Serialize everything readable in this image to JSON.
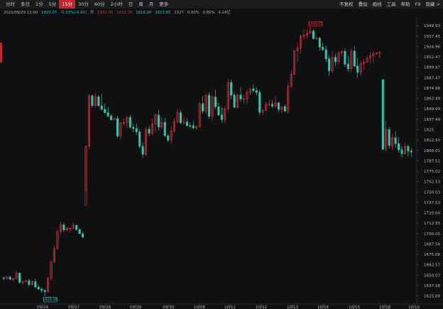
{
  "toolbar": {
    "tabs": [
      {
        "label": "分时",
        "active": false
      },
      {
        "label": "多日",
        "active": false
      },
      {
        "label": "1分",
        "active": false
      },
      {
        "label": "5分",
        "active": false
      },
      {
        "label": "15分",
        "active": true
      },
      {
        "label": "30分",
        "active": false
      },
      {
        "label": "60分",
        "active": false
      },
      {
        "label": "2小时",
        "active": false
      },
      {
        "label": "日",
        "active": false
      },
      {
        "label": "周",
        "active": false
      },
      {
        "label": "月",
        "active": false
      },
      {
        "label": "更多",
        "active": false
      }
    ],
    "right_items": [
      "不复权",
      "叠加",
      "画线",
      "工具",
      "帮助",
      "F9",
      "隐藏 >"
    ]
  },
  "info": {
    "datetime": "2021/09/29 11:00",
    "price": "1820.07",
    "change": "-0.33%(-6.65)",
    "open_label": "开",
    "open": "1832.00",
    "high": "1832.38",
    "low": "1818.00",
    "close": "1823.85",
    "volume": "2327",
    "pct1": "0.00%",
    "pct2": "0.85%",
    "amount": "4.24亿"
  },
  "colors": {
    "up": "#e2373d",
    "down": "#2fc8b0",
    "background": "#0f1011",
    "grid": "#1d1f22"
  },
  "chart_data": {
    "type": "candlestick",
    "y_ticks": [
      "1949.93",
      "1937.45",
      "1924.96",
      "1912.47",
      "1899.97",
      "1887.47",
      "1874.98",
      "1862.49",
      "1849.99",
      "1837.49",
      "1825",
      "1812.50",
      "1800.01",
      "1787.51",
      "1775.02",
      "1762.53",
      "1750.03",
      "1737.53",
      "1725.04",
      "1712.55",
      "1700.05",
      "1687.56",
      "1675.06",
      "1662.57",
      "1650.07",
      "1637.58",
      "1625.08"
    ],
    "x_labels": [
      "09/24",
      "09/27",
      "09/28",
      "09/29",
      "09/30",
      "10/08",
      "10/11",
      "10/12",
      "10/13",
      "10/14",
      "10/15",
      "10/18",
      "10/19"
    ],
    "ylim": [
      1620.5,
      1958.0
    ],
    "annotations": [
      {
        "label": "1949.95",
        "kind": "high"
      },
      {
        "label": "1625.08",
        "kind": "low"
      }
    ],
    "candles": [
      {
        "o": 1646.6,
        "h": 1648.5,
        "l": 1644.1,
        "c": 1646.3
      },
      {
        "o": 1646.3,
        "h": 1648.2,
        "l": 1644.4,
        "c": 1647.9
      },
      {
        "o": 1647.9,
        "h": 1649.2,
        "l": 1644.7,
        "c": 1645.0
      },
      {
        "o": 1645.0,
        "h": 1647.3,
        "l": 1643.2,
        "c": 1646.1
      },
      {
        "o": 1646.1,
        "h": 1655.1,
        "l": 1645.2,
        "c": 1652.4
      },
      {
        "o": 1652.4,
        "h": 1653.8,
        "l": 1640.0,
        "c": 1641.5
      },
      {
        "o": 1641.5,
        "h": 1643.8,
        "l": 1638.2,
        "c": 1642.2
      },
      {
        "o": 1642.2,
        "h": 1644.7,
        "l": 1641.3,
        "c": 1643.4
      },
      {
        "o": 1643.4,
        "h": 1645.4,
        "l": 1636.4,
        "c": 1638.7
      },
      {
        "o": 1638.7,
        "h": 1644.3,
        "l": 1637.5,
        "c": 1642.3
      },
      {
        "o": 1642.3,
        "h": 1646.2,
        "l": 1635.0,
        "c": 1635.7
      },
      {
        "o": 1635.7,
        "h": 1637.6,
        "l": 1632.3,
        "c": 1633.3
      },
      {
        "o": 1633.3,
        "h": 1635.5,
        "l": 1628.7,
        "c": 1631.6
      },
      {
        "o": 1631.6,
        "h": 1633.3,
        "l": 1625.1,
        "c": 1630.3
      },
      {
        "o": 1630.3,
        "h": 1648.2,
        "l": 1628.9,
        "c": 1646.1
      },
      {
        "o": 1646.1,
        "h": 1668.2,
        "l": 1644.1,
        "c": 1666.1
      },
      {
        "o": 1666.1,
        "h": 1685.6,
        "l": 1664.7,
        "c": 1682.1
      },
      {
        "o": 1682.1,
        "h": 1703.8,
        "l": 1681.0,
        "c": 1702.6
      },
      {
        "o": 1702.6,
        "h": 1714.0,
        "l": 1697.7,
        "c": 1710.6
      },
      {
        "o": 1710.6,
        "h": 1713.6,
        "l": 1702.1,
        "c": 1704.4
      },
      {
        "o": 1704.4,
        "h": 1708.3,
        "l": 1702.4,
        "c": 1706.1
      },
      {
        "o": 1706.1,
        "h": 1707.3,
        "l": 1701.4,
        "c": 1706.5
      },
      {
        "o": 1706.5,
        "h": 1712.9,
        "l": 1705.3,
        "c": 1710.0
      },
      {
        "o": 1710.0,
        "h": 1710.6,
        "l": 1703.5,
        "c": 1704.9
      },
      {
        "o": 1704.9,
        "h": 1706.2,
        "l": 1699.3,
        "c": 1699.9
      },
      {
        "o": 1699.9,
        "h": 1702.0,
        "l": 1694.5,
        "c": 1695.9
      },
      {
        "o": 1734.1,
        "h": 1805.8,
        "l": 1750.5,
        "c": 1805.0
      },
      {
        "o": 1805.0,
        "h": 1867.8,
        "l": 1801.6,
        "c": 1865.8
      },
      {
        "o": 1865.8,
        "h": 1867.1,
        "l": 1851.8,
        "c": 1854.0
      },
      {
        "o": 1854.0,
        "h": 1868.6,
        "l": 1851.1,
        "c": 1864.7
      },
      {
        "o": 1864.7,
        "h": 1866.7,
        "l": 1853.2,
        "c": 1853.6
      },
      {
        "o": 1853.6,
        "h": 1868.2,
        "l": 1847.8,
        "c": 1849.5
      },
      {
        "o": 1849.5,
        "h": 1856.2,
        "l": 1844.0,
        "c": 1845.3
      },
      {
        "o": 1845.3,
        "h": 1852.6,
        "l": 1839.9,
        "c": 1841.3
      },
      {
        "o": 1841.3,
        "h": 1843.6,
        "l": 1836.2,
        "c": 1836.8
      },
      {
        "o": 1836.8,
        "h": 1839.6,
        "l": 1836.0,
        "c": 1838.3
      },
      {
        "o": 1838.3,
        "h": 1841.6,
        "l": 1814.5,
        "c": 1817.3
      },
      {
        "o": 1817.3,
        "h": 1834.4,
        "l": 1812.9,
        "c": 1832.7
      },
      {
        "o": 1832.7,
        "h": 1838.2,
        "l": 1829.7,
        "c": 1833.2
      },
      {
        "o": 1833.2,
        "h": 1841.2,
        "l": 1827.1,
        "c": 1839.8
      },
      {
        "o": 1839.8,
        "h": 1842.5,
        "l": 1826.5,
        "c": 1827.9
      },
      {
        "o": 1827.9,
        "h": 1832.8,
        "l": 1821.8,
        "c": 1826.5
      },
      {
        "o": 1826.5,
        "h": 1832.6,
        "l": 1818.9,
        "c": 1822.2
      },
      {
        "o": 1822.2,
        "h": 1824.7,
        "l": 1802.1,
        "c": 1805.0
      },
      {
        "o": 1805.0,
        "h": 1809.8,
        "l": 1790.9,
        "c": 1795.4
      },
      {
        "o": 1795.4,
        "h": 1828.4,
        "l": 1793.2,
        "c": 1825.4
      },
      {
        "o": 1825.4,
        "h": 1829.2,
        "l": 1817.5,
        "c": 1820.8
      },
      {
        "o": 1820.8,
        "h": 1838.2,
        "l": 1817.8,
        "c": 1831.7
      },
      {
        "o": 1831.7,
        "h": 1844.5,
        "l": 1821.5,
        "c": 1842.6
      },
      {
        "o": 1842.6,
        "h": 1848.7,
        "l": 1824.4,
        "c": 1828.1
      },
      {
        "o": 1828.1,
        "h": 1839.6,
        "l": 1825.6,
        "c": 1833.6
      },
      {
        "o": 1833.6,
        "h": 1839.3,
        "l": 1816.4,
        "c": 1817.6
      },
      {
        "o": 1817.6,
        "h": 1819.9,
        "l": 1809.8,
        "c": 1812.5
      },
      {
        "o": 1812.5,
        "h": 1828.5,
        "l": 1808.3,
        "c": 1823.6
      },
      {
        "o": 1823.6,
        "h": 1838.3,
        "l": 1821.0,
        "c": 1834.7
      },
      {
        "o": 1834.7,
        "h": 1850.3,
        "l": 1832.2,
        "c": 1845.3
      },
      {
        "o": 1845.3,
        "h": 1847.9,
        "l": 1831.4,
        "c": 1833.4
      },
      {
        "o": 1833.4,
        "h": 1840.6,
        "l": 1830.5,
        "c": 1834.2
      },
      {
        "o": 1834.2,
        "h": 1838.4,
        "l": 1828.4,
        "c": 1829.8
      },
      {
        "o": 1829.8,
        "h": 1833.4,
        "l": 1826.7,
        "c": 1829.7
      },
      {
        "o": 1829.7,
        "h": 1835.2,
        "l": 1825.3,
        "c": 1827.0
      },
      {
        "o": 1827.0,
        "h": 1830.0,
        "l": 1825.0,
        "c": 1828.5
      },
      {
        "o": 1828.5,
        "h": 1858.4,
        "l": 1827.4,
        "c": 1856.1
      },
      {
        "o": 1856.1,
        "h": 1865.4,
        "l": 1845.2,
        "c": 1847.3
      },
      {
        "o": 1847.3,
        "h": 1868.5,
        "l": 1844.5,
        "c": 1866.3
      },
      {
        "o": 1866.3,
        "h": 1869.6,
        "l": 1838.1,
        "c": 1840.9
      },
      {
        "o": 1840.9,
        "h": 1866.2,
        "l": 1835.8,
        "c": 1864.2
      },
      {
        "o": 1864.2,
        "h": 1873.1,
        "l": 1849.8,
        "c": 1852.5
      },
      {
        "o": 1852.5,
        "h": 1857.2,
        "l": 1841.0,
        "c": 1842.7
      },
      {
        "o": 1842.7,
        "h": 1852.0,
        "l": 1833.5,
        "c": 1837.1
      },
      {
        "o": 1837.1,
        "h": 1853.4,
        "l": 1833.3,
        "c": 1850.0
      },
      {
        "o": 1850.0,
        "h": 1885.8,
        "l": 1846.4,
        "c": 1881.7
      },
      {
        "o": 1881.7,
        "h": 1885.3,
        "l": 1861.4,
        "c": 1866.6
      },
      {
        "o": 1866.6,
        "h": 1869.1,
        "l": 1850.6,
        "c": 1851.8
      },
      {
        "o": 1851.8,
        "h": 1868.2,
        "l": 1850.5,
        "c": 1866.5
      },
      {
        "o": 1866.5,
        "h": 1875.7,
        "l": 1858.4,
        "c": 1861.7
      },
      {
        "o": 1861.7,
        "h": 1866.4,
        "l": 1856.0,
        "c": 1862.0
      },
      {
        "o": 1862.0,
        "h": 1873.4,
        "l": 1855.9,
        "c": 1869.6
      },
      {
        "o": 1869.6,
        "h": 1874.3,
        "l": 1866.4,
        "c": 1874.1
      },
      {
        "o": 1874.1,
        "h": 1879.5,
        "l": 1869.8,
        "c": 1871.9
      },
      {
        "o": 1871.9,
        "h": 1875.4,
        "l": 1866.3,
        "c": 1869.8
      },
      {
        "o": 1869.8,
        "h": 1872.8,
        "l": 1842.4,
        "c": 1845.9
      },
      {
        "o": 1845.9,
        "h": 1849.5,
        "l": 1842.3,
        "c": 1848.4
      },
      {
        "o": 1848.4,
        "h": 1858.0,
        "l": 1846.4,
        "c": 1855.2
      },
      {
        "o": 1855.2,
        "h": 1860.6,
        "l": 1852.7,
        "c": 1855.4
      },
      {
        "o": 1855.4,
        "h": 1861.0,
        "l": 1851.4,
        "c": 1853.3
      },
      {
        "o": 1853.3,
        "h": 1866.1,
        "l": 1851.8,
        "c": 1857.1
      },
      {
        "o": 1857.1,
        "h": 1858.4,
        "l": 1846.6,
        "c": 1849.4
      },
      {
        "o": 1849.4,
        "h": 1852.9,
        "l": 1844.9,
        "c": 1852.6
      },
      {
        "o": 1852.6,
        "h": 1855.5,
        "l": 1845.7,
        "c": 1847.3
      },
      {
        "o": 1847.3,
        "h": 1881.1,
        "l": 1844.2,
        "c": 1877.2
      },
      {
        "o": 1877.2,
        "h": 1895.7,
        "l": 1875.5,
        "c": 1891.5
      },
      {
        "o": 1891.5,
        "h": 1921.3,
        "l": 1890.1,
        "c": 1919.8
      },
      {
        "o": 1919.8,
        "h": 1929.4,
        "l": 1906.6,
        "c": 1922.9
      },
      {
        "o": 1922.9,
        "h": 1940.0,
        "l": 1916.0,
        "c": 1937.0
      },
      {
        "o": 1937.0,
        "h": 1946.2,
        "l": 1933.3,
        "c": 1938.7
      },
      {
        "o": 1938.7,
        "h": 1945.3,
        "l": 1934.3,
        "c": 1940.9
      },
      {
        "o": 1940.9,
        "h": 1949.9,
        "l": 1940.7,
        "c": 1943.5
      },
      {
        "o": 1943.5,
        "h": 1945.7,
        "l": 1933.1,
        "c": 1934.5
      },
      {
        "o": 1934.5,
        "h": 1937.0,
        "l": 1932.5,
        "c": 1935.1
      },
      {
        "o": 1935.1,
        "h": 1935.9,
        "l": 1920.1,
        "c": 1924.2
      },
      {
        "o": 1924.2,
        "h": 1929.4,
        "l": 1919.4,
        "c": 1921.2
      },
      {
        "o": 1921.2,
        "h": 1925.7,
        "l": 1906.4,
        "c": 1910.2
      },
      {
        "o": 1910.2,
        "h": 1914.5,
        "l": 1889.4,
        "c": 1895.9
      },
      {
        "o": 1895.9,
        "h": 1918.9,
        "l": 1893.3,
        "c": 1911.9
      },
      {
        "o": 1911.9,
        "h": 1916.1,
        "l": 1901.9,
        "c": 1906.6
      },
      {
        "o": 1906.6,
        "h": 1920.0,
        "l": 1903.2,
        "c": 1917.4
      },
      {
        "o": 1917.4,
        "h": 1920.7,
        "l": 1913.6,
        "c": 1919.3
      },
      {
        "o": 1919.3,
        "h": 1922.3,
        "l": 1900.4,
        "c": 1903.8
      },
      {
        "o": 1903.8,
        "h": 1913.9,
        "l": 1895.0,
        "c": 1898.3
      },
      {
        "o": 1898.3,
        "h": 1922.4,
        "l": 1893.8,
        "c": 1919.4
      },
      {
        "o": 1919.4,
        "h": 1925.0,
        "l": 1900.1,
        "c": 1901.6
      },
      {
        "o": 1901.6,
        "h": 1911.0,
        "l": 1887.8,
        "c": 1894.1
      },
      {
        "o": 1894.1,
        "h": 1908.2,
        "l": 1890.0,
        "c": 1904.2
      },
      {
        "o": 1904.2,
        "h": 1909.5,
        "l": 1896.5,
        "c": 1906.0
      },
      {
        "o": 1906.0,
        "h": 1913.6,
        "l": 1905.0,
        "c": 1910.7
      },
      {
        "o": 1910.7,
        "h": 1918.9,
        "l": 1903.9,
        "c": 1913.9
      },
      {
        "o": 1913.9,
        "h": 1920.0,
        "l": 1905.0,
        "c": 1916.3
      },
      {
        "o": 1916.3,
        "h": 1918.4,
        "l": 1914.9,
        "c": 1916.8
      },
      {
        "o": 1916.8,
        "h": 1919.1,
        "l": 1910.8,
        "c": 1917.9
      },
      {
        "o": 1885.2,
        "h": 1885.2,
        "l": 1800.8,
        "c": 1801.3
      },
      {
        "o": 1801.3,
        "h": 1835.7,
        "l": 1798.9,
        "c": 1825.1
      },
      {
        "o": 1825.1,
        "h": 1827.9,
        "l": 1802.0,
        "c": 1805.9
      },
      {
        "o": 1805.9,
        "h": 1820.2,
        "l": 1800.5,
        "c": 1815.2
      },
      {
        "o": 1815.2,
        "h": 1823.1,
        "l": 1803.6,
        "c": 1808.2
      },
      {
        "o": 1808.2,
        "h": 1815.9,
        "l": 1797.5,
        "c": 1800.7
      },
      {
        "o": 1800.7,
        "h": 1805.0,
        "l": 1791.5,
        "c": 1796.1
      },
      {
        "o": 1796.1,
        "h": 1808.8,
        "l": 1794.9,
        "c": 1804.8
      },
      {
        "o": 1804.8,
        "h": 1807.1,
        "l": 1792.9,
        "c": 1799.3
      },
      {
        "o": 1799.3,
        "h": 1802.3,
        "l": 1792.2,
        "c": 1798.2
      }
    ]
  }
}
